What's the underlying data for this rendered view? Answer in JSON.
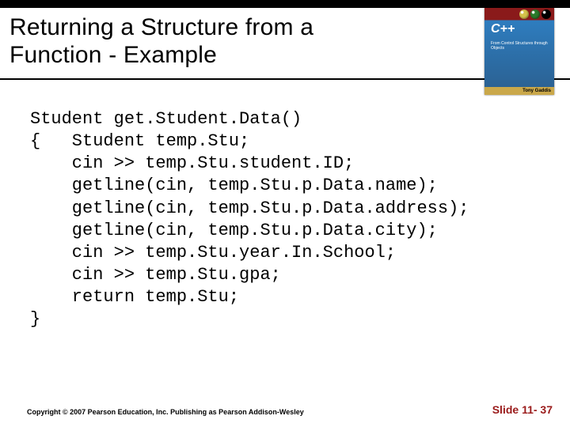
{
  "header": {
    "title_line1": "Returning a Structure from a",
    "title_line2": "Function - Example"
  },
  "book": {
    "lang": "C++",
    "subtitle": "From Control Structures through Objects",
    "author": "Tony Gaddis"
  },
  "code": {
    "l1": "Student get.Student.Data()",
    "l2": "{   Student temp.Stu;",
    "l3": "    cin >> temp.Stu.student.ID;",
    "l4": "    getline(cin, temp.Stu.p.Data.name);",
    "l5": "    getline(cin, temp.Stu.p.Data.address);",
    "l6": "    getline(cin, temp.Stu.p.Data.city);",
    "l7": "    cin >> temp.Stu.year.In.School;",
    "l8": "    cin >> temp.Stu.gpa;",
    "l9": "    return temp.Stu;",
    "l10": "}"
  },
  "footer": {
    "copyright": "Copyright © 2007 Pearson Education, Inc. Publishing as Pearson Addison-Wesley",
    "slide": "Slide 11- 37"
  }
}
